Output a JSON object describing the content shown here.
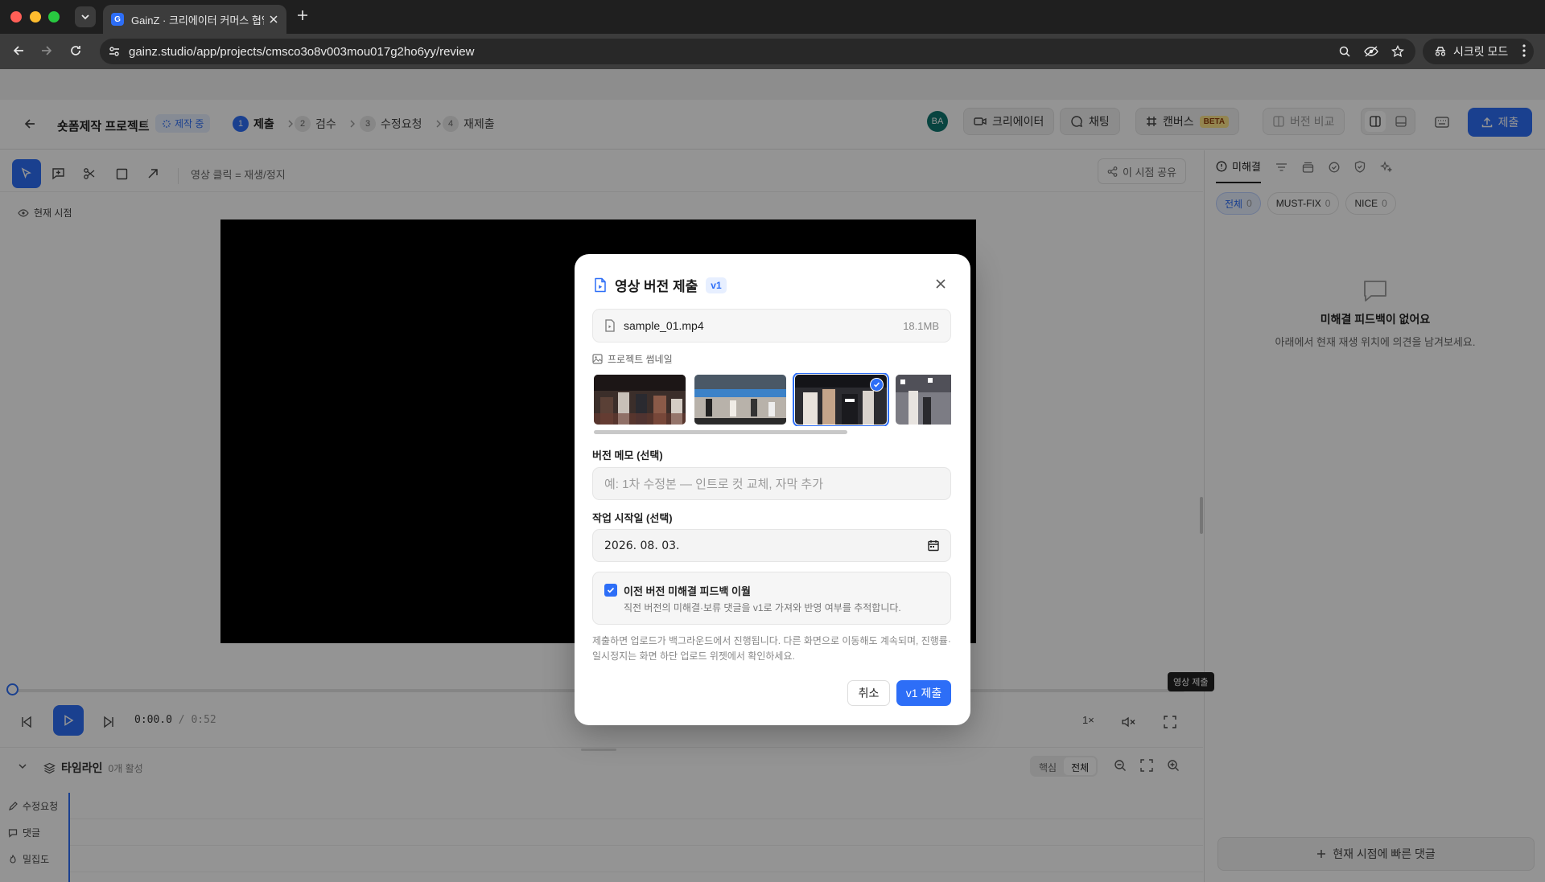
{
  "browser": {
    "tab_title": "GainZ · 크리에이터 커머스 협업 O",
    "favicon_letter": "G",
    "url": "gainz.studio/app/projects/cmsco3o8v003mou017g2ho6yy/review",
    "incognito_label": "시크릿 모드"
  },
  "header": {
    "project_title": "숏폼제작 프로젝트",
    "separator": "/",
    "status_badge": "제작 중",
    "steps": [
      {
        "num": "1",
        "label": "제출"
      },
      {
        "num": "2",
        "label": "검수"
      },
      {
        "num": "3",
        "label": "수정요청"
      },
      {
        "num": "4",
        "label": "재제출"
      }
    ],
    "avatar_initials": "BA",
    "creator_label": "크리에이터",
    "chat_label": "채팅",
    "canvas_label": "캔버스",
    "beta_label": "BETA",
    "compare_label": "버전 비교",
    "submit_label": "제출"
  },
  "player": {
    "hint": "영상 클릭 = 재생/정지",
    "share_label": "이 시점 공유",
    "now_label": "현재 시점",
    "time_current": "0:00.0",
    "time_duration": "/ 0:52",
    "speed": "1×",
    "progress_fraction": 0
  },
  "timeline": {
    "title": "타임라인",
    "active_count": "0개 활성",
    "seg_core": "핵심",
    "seg_all": "전체",
    "rows": [
      "수정요청",
      "댓글",
      "밀집도"
    ]
  },
  "right_panel": {
    "tab_unresolved": "미해결",
    "chips": [
      {
        "label": "전체",
        "count": "0"
      },
      {
        "label": "MUST-FIX",
        "count": "0"
      },
      {
        "label": "NICE",
        "count": "0"
      }
    ],
    "empty_title": "미해결 피드백이 없어요",
    "empty_sub": "아래에서 현재 재생 위치에 의견을 남겨보세요.",
    "quick_comment": "현재 시점에 빠른 댓글",
    "tooltip": "영상 제출"
  },
  "modal": {
    "title": "영상 버전 제출",
    "version_badge": "v1",
    "file_name": "sample_01.mp4",
    "file_size": "18.1MB",
    "thumb_label": "프로젝트 썸네일",
    "memo_label": "버전 메모 (선택)",
    "memo_placeholder": "예: 1차 수정본 — 인트로 컷 교체, 자막 추가",
    "start_label": "작업 시작일 (선택)",
    "start_value": "2026. 08. 03.",
    "carry_title": "이전 버전 미해결 피드백 이월",
    "carry_sub": "직전 버전의 미해결·보류 댓글을 v1로 가져와 반영 여부를 추적합니다.",
    "carry_checked": true,
    "notice": "제출하면 업로드가 백그라운드에서 진행됩니다. 다른 화면으로 이동해도 계속되며, 진행률·일시정지는 화면 하단 업로드 위젯에서 확인하세요.",
    "cancel_label": "취소",
    "submit_label": "v1 제출"
  },
  "colors": {
    "accent": "#2d6ef7",
    "chrome_dark": "#1f1f1f",
    "overlay": "rgba(0,0,0,0.42)"
  }
}
